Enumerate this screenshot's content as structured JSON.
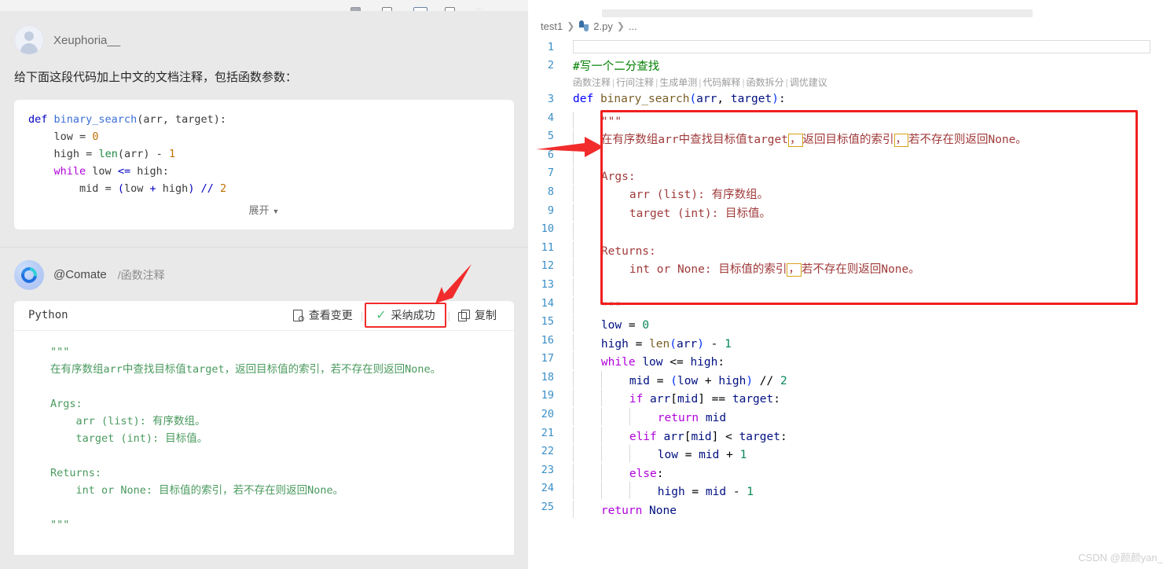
{
  "chat": {
    "toolbar_label": "...",
    "user": {
      "name": "Xeuphoria__",
      "avatar_icon": "user-avatar-icon",
      "prompt": "给下面这段代码加上中文的文档注释，包括函数参数：",
      "code_lines": [
        "def binary_search(arr, target):",
        "    low = 0",
        "    high = len(arr) - 1",
        "    while low <= high:",
        "        mid = (low + high) // 2"
      ],
      "expand_label": "展开",
      "expand_caret": "▼"
    },
    "bot": {
      "avatar_icon": "comate-logo-icon",
      "name": "@Comate",
      "command": "/函数注释",
      "lang": "Python",
      "actions": [
        {
          "label": "查看变更",
          "icon": "doc-search-icon",
          "highlighted": false
        },
        {
          "label": "采纳成功",
          "icon": "check-icon",
          "highlighted": true
        },
        {
          "label": "复制",
          "icon": "copy-icon",
          "highlighted": false
        }
      ],
      "docstring": "\"\"\"\n在有序数组arr中查找目标值target，返回目标值的索引，若不存在则返回None。\n\nArgs:\n    arr (list): 有序数组。\n    target (int): 目标值。\n\nReturns:\n    int or None: 目标值的索引，若不存在则返回None。\n\n\"\"\""
    }
  },
  "editor": {
    "breadcrumb": {
      "project": "test1",
      "file": "2.py",
      "more": "...",
      "sep": "❯",
      "file_icon": "python-file-icon"
    },
    "codelens": [
      "函数注释",
      "行间注释",
      "生成单测",
      "代码解释",
      "函数拆分",
      "调优建议"
    ],
    "codelens_sep": "|",
    "line_numbers": [
      1,
      2,
      3,
      4,
      5,
      6,
      7,
      8,
      9,
      10,
      11,
      12,
      13,
      14,
      15,
      16,
      17,
      18,
      19,
      20,
      21,
      22,
      23,
      24,
      25
    ],
    "lines": {
      "l2_comment": "#写一个二分查找",
      "l3": "def binary_search(arr, target):",
      "l4": "\"\"\"",
      "l5_a": "在有序数组arr中查找目标值target",
      "l5_c1": "，",
      "l5_b": "返回目标值的索引",
      "l5_c2": "，",
      "l5_d": "若不存在则返回None。",
      "l7": "Args:",
      "l8": "arr (list): 有序数组。",
      "l9": "target (int): 目标值。",
      "l11": "Returns:",
      "l12_a": "int or None: 目标值的索引",
      "l12_c": "，",
      "l12_b": "若不存在则返回None。",
      "l14": "\"\"\"",
      "l15": "low = 0",
      "l16": "high = len(arr) - 1",
      "l17": "while low <= high:",
      "l18": "mid = (low + high) // 2",
      "l19": "if arr[mid] == target:",
      "l20": "return mid",
      "l21": "elif arr[mid] < target:",
      "l22": "low = mid + 1",
      "l23": "else:",
      "l24": "high = mid - 1",
      "l25": "return None"
    }
  },
  "annotations": {
    "red_box_editor": "docstring-highlight-box",
    "red_box_button": "adopt-button-highlight-box",
    "arrow_right": "red-arrow-right",
    "arrow_down_left": "red-arrow-down-left"
  },
  "watermark": "CSDN @颜颜yan_",
  "colors": {
    "accent_red": "#f02020",
    "green_check": "#52c07a",
    "docstring_green": "#4a9a5e",
    "docstring_red": "#a03a3a",
    "gutter_blue": "#3b8fc7",
    "highlight_yellow": "#d7a21a"
  }
}
